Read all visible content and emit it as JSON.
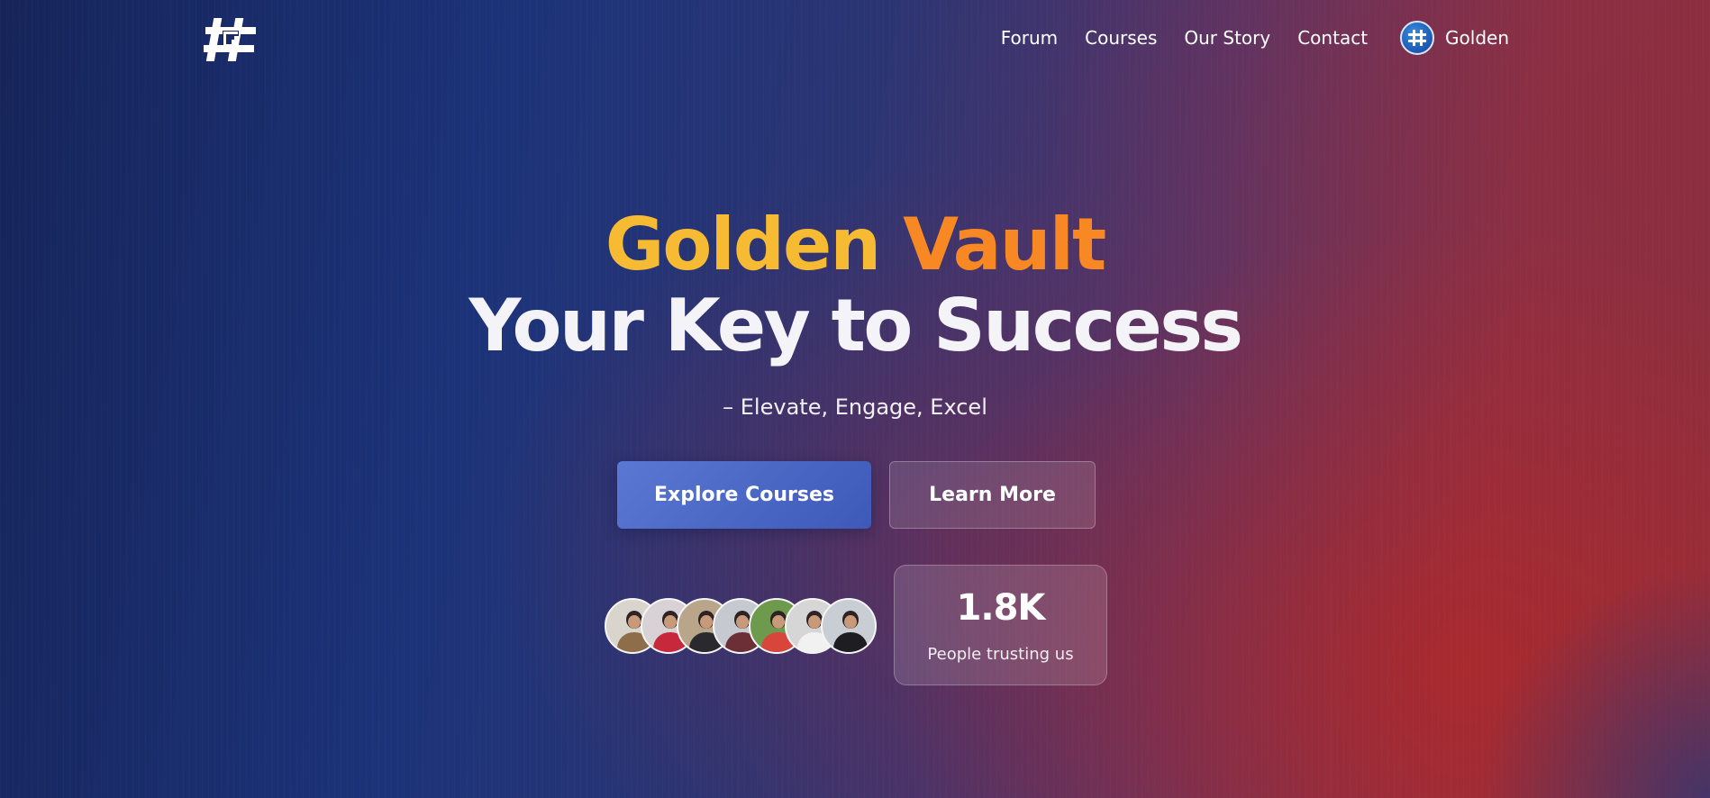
{
  "brand": {
    "logo_icon": "gv-hash-logo-icon"
  },
  "nav": {
    "links": [
      "Forum",
      "Courses",
      "Our Story",
      "Contact"
    ],
    "user": {
      "avatar_icon": "user-avatar-icon",
      "name": "Golden"
    }
  },
  "hero": {
    "title_word1": "Golden",
    "title_word2": "Vault",
    "title_line2": "Your Key to Success",
    "subtitle": "– Elevate, Engage, Excel",
    "primary_button": "Explore Courses",
    "secondary_button": "Learn More"
  },
  "social_proof": {
    "avatar_count": 7,
    "stat_value": "1.8K",
    "stat_label": "People trusting us"
  },
  "colors": {
    "gold": "#f7bb33",
    "orange": "#f78823",
    "primary_button": "#4b67c6",
    "background_blue": "#1c3379",
    "background_red": "#a9302e"
  }
}
